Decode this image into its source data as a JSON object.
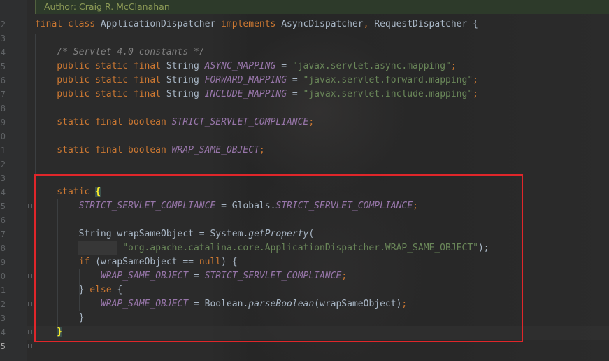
{
  "editor": {
    "author_label": "Author: Craig R. McClanahan",
    "lines": [
      {
        "num": "2",
        "segments": [
          {
            "t": "final class ",
            "c": "kw"
          },
          {
            "t": "ApplicationDispatcher ",
            "c": ""
          },
          {
            "t": "implements ",
            "c": "kw"
          },
          {
            "t": "AsyncDispatcher",
            "c": ""
          },
          {
            "t": ", ",
            "c": "kw"
          },
          {
            "t": "RequestDispatcher {",
            "c": ""
          }
        ]
      },
      {
        "num": "3",
        "segments": []
      },
      {
        "num": "4",
        "segments": [
          {
            "t": "    ",
            "c": ""
          },
          {
            "t": "/* Servlet 4.0 constants */",
            "c": "cmt"
          }
        ]
      },
      {
        "num": "5",
        "segments": [
          {
            "t": "    public static final ",
            "c": "kw"
          },
          {
            "t": "String ",
            "c": ""
          },
          {
            "t": "ASYNC_MAPPING",
            "c": "fld"
          },
          {
            "t": " = ",
            "c": ""
          },
          {
            "t": "\"javax.servlet.async.mapping\"",
            "c": "str"
          },
          {
            "t": ";",
            "c": "kw"
          }
        ]
      },
      {
        "num": "6",
        "segments": [
          {
            "t": "    public static final ",
            "c": "kw"
          },
          {
            "t": "String ",
            "c": ""
          },
          {
            "t": "FORWARD_MAPPING",
            "c": "fld"
          },
          {
            "t": " = ",
            "c": ""
          },
          {
            "t": "\"javax.servlet.forward.mapping\"",
            "c": "str"
          },
          {
            "t": ";",
            "c": "kw"
          }
        ]
      },
      {
        "num": "7",
        "segments": [
          {
            "t": "    public static final ",
            "c": "kw"
          },
          {
            "t": "String ",
            "c": ""
          },
          {
            "t": "INCLUDE_MAPPING",
            "c": "fld"
          },
          {
            "t": " = ",
            "c": ""
          },
          {
            "t": "\"javax.servlet.include.mapping\"",
            "c": "str"
          },
          {
            "t": ";",
            "c": "kw"
          }
        ]
      },
      {
        "num": "8",
        "segments": []
      },
      {
        "num": "9",
        "segments": [
          {
            "t": "    static final boolean ",
            "c": "kw"
          },
          {
            "t": "STRICT_SERVLET_COMPLIANCE",
            "c": "fld"
          },
          {
            "t": ";",
            "c": "kw"
          }
        ]
      },
      {
        "num": "0",
        "segments": []
      },
      {
        "num": "1",
        "segments": [
          {
            "t": "    static final boolean ",
            "c": "kw"
          },
          {
            "t": "WRAP_SAME_OBJECT",
            "c": "fld"
          },
          {
            "t": ";",
            "c": "kw"
          }
        ]
      },
      {
        "num": "2",
        "segments": []
      },
      {
        "num": "3",
        "segments": []
      },
      {
        "num": "4",
        "segments": [
          {
            "t": "    static ",
            "c": "kw"
          },
          {
            "t": "{",
            "c": "brace-hl"
          }
        ]
      },
      {
        "num": "5",
        "segments": [
          {
            "t": "        ",
            "c": ""
          },
          {
            "t": "STRICT_SERVLET_COMPLIANCE",
            "c": "fld"
          },
          {
            "t": " = Globals.",
            "c": ""
          },
          {
            "t": "STRICT_SERVLET_COMPLIANCE",
            "c": "fld"
          },
          {
            "t": ";",
            "c": "kw"
          }
        ]
      },
      {
        "num": "6",
        "segments": []
      },
      {
        "num": "7",
        "segments": [
          {
            "t": "        String wrapSameObject = System.",
            "c": ""
          },
          {
            "t": "getProperty",
            "c": "mth"
          },
          {
            "t": "(",
            "c": ""
          }
        ]
      },
      {
        "num": "8",
        "segments": [
          {
            "t": "                ",
            "c": ""
          },
          {
            "t": "\"org.apache.catalina.core.ApplicationDispatcher.WRAP_SAME_OBJECT\"",
            "c": "str"
          },
          {
            "t": ");",
            "c": ""
          }
        ]
      },
      {
        "num": "9",
        "segments": [
          {
            "t": "        ",
            "c": ""
          },
          {
            "t": "if ",
            "c": "kw"
          },
          {
            "t": "(wrapSameObject == ",
            "c": ""
          },
          {
            "t": "null",
            "c": "kw"
          },
          {
            "t": ") {",
            "c": ""
          }
        ]
      },
      {
        "num": "0",
        "segments": [
          {
            "t": "            ",
            "c": ""
          },
          {
            "t": "WRAP_SAME_OBJECT",
            "c": "fld"
          },
          {
            "t": " = ",
            "c": ""
          },
          {
            "t": "STRICT_SERVLET_COMPLIANCE",
            "c": "fld"
          },
          {
            "t": ";",
            "c": "kw"
          }
        ]
      },
      {
        "num": "1",
        "segments": [
          {
            "t": "        } ",
            "c": ""
          },
          {
            "t": "else ",
            "c": "kw"
          },
          {
            "t": "{",
            "c": ""
          }
        ]
      },
      {
        "num": "2",
        "segments": [
          {
            "t": "            ",
            "c": ""
          },
          {
            "t": "WRAP_SAME_OBJECT",
            "c": "fld"
          },
          {
            "t": " = Boolean.",
            "c": ""
          },
          {
            "t": "parseBoolean",
            "c": "mth"
          },
          {
            "t": "(wrapSameObject)",
            "c": ""
          },
          {
            "t": ";",
            "c": "kw"
          }
        ]
      },
      {
        "num": "3",
        "segments": [
          {
            "t": "        }",
            "c": ""
          }
        ]
      },
      {
        "num": "4",
        "segments": [
          {
            "t": "    ",
            "c": ""
          },
          {
            "t": "}",
            "c": "brace-hl"
          }
        ]
      },
      {
        "num": "5",
        "segments": []
      }
    ]
  },
  "colors": {
    "keyword": "#cc7832",
    "field": "#9876aa",
    "string": "#6a8759",
    "comment": "#808080",
    "default_text": "#a9b7c6",
    "highlight_box": "#e0262a"
  }
}
